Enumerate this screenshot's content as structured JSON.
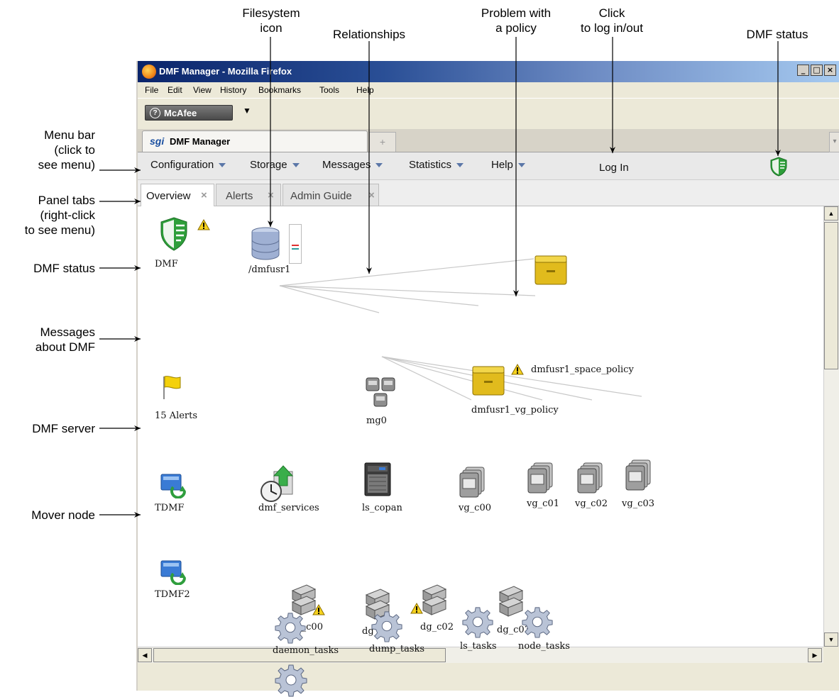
{
  "callouts": {
    "filesystem_icon": "Filesystem\nicon",
    "relationships": "Relationships",
    "problem_policy": "Problem with\na policy",
    "login": "Click\nto log in/out",
    "dmf_status_top": "DMF status",
    "menu_bar": "Menu bar\n(click to\nsee menu)",
    "panel_tabs": "Panel tabs\n(right-click\nto see menu)",
    "dmf_status_left": "DMF status",
    "messages": "Messages\nabout DMF",
    "dmf_server": "DMF server",
    "mover_node": "Mover node"
  },
  "window": {
    "title": "DMF Manager - Mozilla Firefox",
    "buttons": [
      "_",
      "□",
      "×"
    ]
  },
  "firefox_menu": [
    "File",
    "Edit",
    "View",
    "History",
    "Bookmarks",
    "Tools",
    "Help"
  ],
  "toolbar": {
    "mcafee_label": "McAfee",
    "mcafee_icon": "?",
    "dropdown": "▼"
  },
  "browser_tab": {
    "logo": "sgi",
    "label": "DMF Manager",
    "newtab": "+"
  },
  "app_menu": [
    {
      "label": "Configuration"
    },
    {
      "label": "Storage"
    },
    {
      "label": "Messages"
    },
    {
      "label": "Statistics"
    },
    {
      "label": "Help"
    }
  ],
  "login_label": "Log In",
  "panel_tabs": [
    {
      "label": "Overview",
      "close": "×",
      "active": true
    },
    {
      "label": "Alerts",
      "close": "×",
      "active": false
    },
    {
      "label": "Admin Guide",
      "close": "×",
      "active": false
    }
  ],
  "nodes": {
    "dmf": "DMF",
    "alerts": "15 Alerts",
    "tdmf": "TDMF",
    "tdmf2": "TDMF2",
    "filesystem": "/dmfusr1",
    "mg0": "mg0",
    "space_policy": "dmfusr1_space_policy",
    "vg_policy": "dmfusr1_vg_policy",
    "dmf_services": "dmf_services",
    "ls_copan": "ls_copan",
    "vg_c00": "vg_c00",
    "vg_c01": "vg_c01",
    "vg_c02": "vg_c02",
    "vg_c03": "vg_c03",
    "dg_c00": "dg_c00",
    "dg_c01": "dg_c01",
    "dg_c02": "dg_c02",
    "dg_c03": "dg_c03",
    "daemon_tasks": "daemon_tasks",
    "dump_tasks": "dump_tasks",
    "ls_tasks": "ls_tasks",
    "node_tasks": "node_tasks"
  },
  "icons": {
    "shield": "shield-icon",
    "warning": "warning-icon",
    "flag": "flag-icon",
    "server": "server-icon",
    "database": "database-icon",
    "folder": "policy-folder-icon",
    "cabinet": "tape-cabinet-icon",
    "tape_group": "volume-group-icon",
    "disk_group": "drive-group-icon",
    "gear": "gear-icon",
    "services": "services-icon"
  },
  "colors": {
    "shield_green": "#2e9e3a",
    "warning_yellow": "#f6d21d",
    "folder_gold": "#d8b21c",
    "menu_arrow": "#5b77a8"
  }
}
